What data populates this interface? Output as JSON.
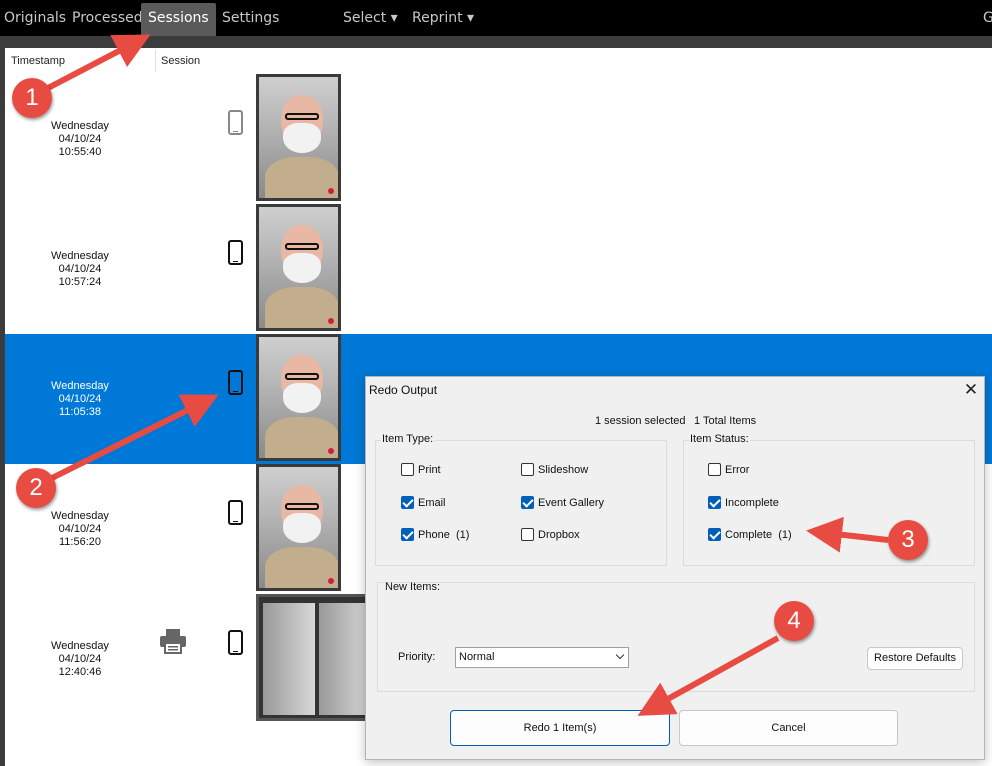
{
  "nav": {
    "tabs": [
      "Originals",
      "Processed",
      "Sessions",
      "Settings",
      "Select ▾",
      "Reprint ▾"
    ],
    "active": "Sessions",
    "edge_letter": "G"
  },
  "table": {
    "headers": {
      "timestamp": "Timestamp",
      "session": "Session"
    },
    "rows": [
      {
        "day": "Wednesday",
        "date": "04/10/24",
        "time": "10:55:40"
      },
      {
        "day": "Wednesday",
        "date": "04/10/24",
        "time": "10:57:24"
      },
      {
        "day": "Wednesday",
        "date": "04/10/24",
        "time": "11:05:38"
      },
      {
        "day": "Wednesday",
        "date": "04/10/24",
        "time": "11:56:20"
      },
      {
        "day": "Wednesday",
        "date": "04/10/24",
        "time": "12:40:46"
      }
    ]
  },
  "dialog": {
    "title": "Redo Output",
    "close": "✕",
    "sessions_selected": "1 session selected",
    "total_items": "1 Total Items",
    "item_type": {
      "title": "Item Type:",
      "print": "Print",
      "email": "Email",
      "phone": "Phone",
      "phone_count": "(1)",
      "slideshow": "Slideshow",
      "event_gallery": "Event Gallery",
      "dropbox": "Dropbox"
    },
    "item_status": {
      "title": "Item Status:",
      "error": "Error",
      "incomplete": "Incomplete",
      "complete": "Complete",
      "complete_count": "(1)"
    },
    "new_items": {
      "title": "New Items:",
      "priority_label": "Priority:",
      "priority_value": "Normal",
      "restore": "Restore Defaults"
    },
    "redo_button": "Redo 1 Item(s)",
    "cancel_button": "Cancel"
  },
  "annotations": [
    "1",
    "2",
    "3",
    "4"
  ],
  "colors": {
    "selected_row": "#0078d7",
    "arrow": "#e84b42",
    "accent": "#005fb8"
  }
}
